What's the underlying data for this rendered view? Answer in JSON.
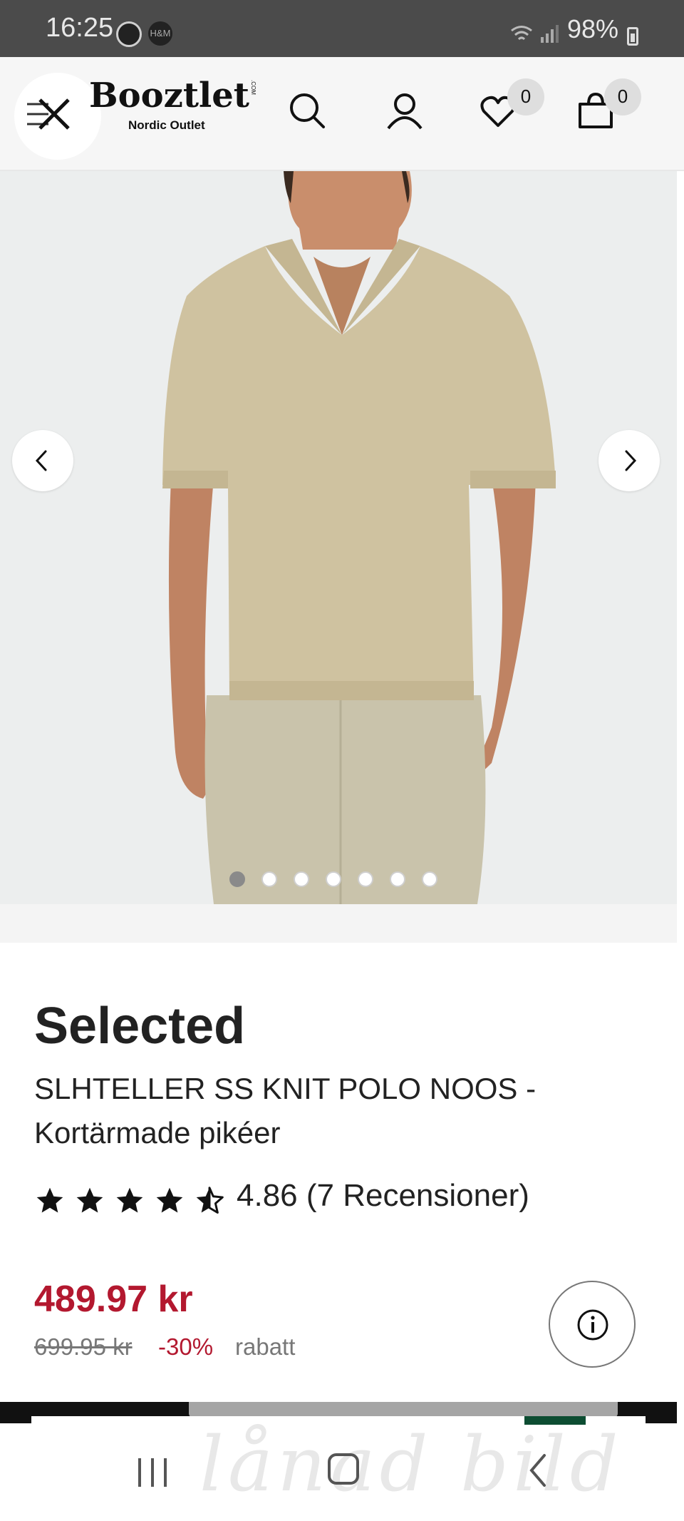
{
  "status_bar": {
    "time": "16:25",
    "battery": "98%",
    "notification_icons": [
      "viber-icon",
      "hm-icon"
    ]
  },
  "header": {
    "logo_text": "Booztlet",
    "logo_com": ".COM",
    "logo_subtitle": "Nordic Outlet",
    "wishlist_count": "0",
    "cart_count": "0",
    "icons": [
      "close-icon",
      "search-icon",
      "account-icon",
      "heart-icon",
      "bag-icon"
    ]
  },
  "gallery": {
    "image_count": 7,
    "active_index": 0,
    "image_description_icon": "product-photo"
  },
  "product": {
    "brand": "Selected",
    "name": "SLHTELLER SS KNIT POLO NOOS - Kortärmade pikéer",
    "rating_stars": 4.86,
    "rating_text": "4.86 (7 Recensioner)",
    "price": "489.97 kr",
    "old_price": "699.95 kr",
    "discount": "-30%",
    "discount_label": "rabatt"
  },
  "system_nav": {
    "watermark": "lånad bild"
  },
  "colors": {
    "price_red": "#b3182f",
    "header_bg": "#f6f6f6",
    "image_bg": "#eceeee"
  }
}
